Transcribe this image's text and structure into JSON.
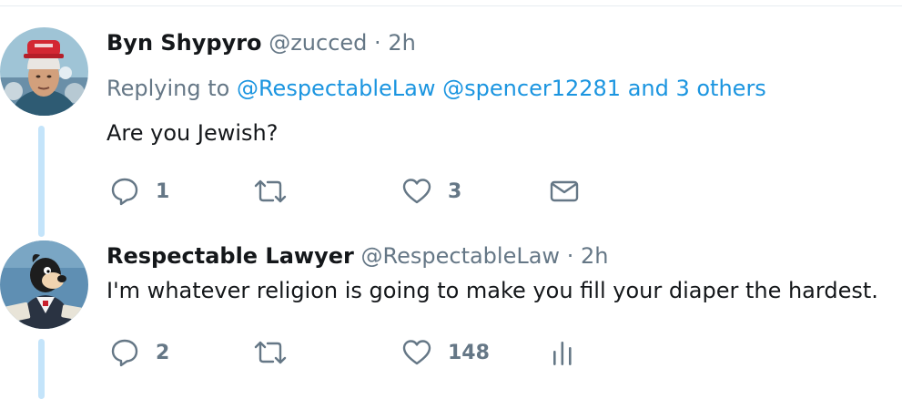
{
  "tweets": [
    {
      "display_name": "Byn Shypyro",
      "handle": "@zucced",
      "separator": "·",
      "time": "2h",
      "reply": {
        "prefix": "Replying to",
        "mentions": [
          "@RespectableLaw",
          "@spencer12281"
        ],
        "suffix": "and 3 others"
      },
      "text": "Are you Jewish?",
      "actions": {
        "reply_icon": "reply-icon",
        "reply_count": "1",
        "retweet_icon": "retweet-icon",
        "like_icon": "heart-icon",
        "like_count": "3",
        "extra_icon": "envelope-icon"
      }
    },
    {
      "display_name": "Respectable Lawyer",
      "handle": "@RespectableLaw",
      "separator": "·",
      "time": "2h",
      "text": "I'm whatever religion is going to make you fill your diaper the hardest.",
      "actions": {
        "reply_icon": "reply-icon",
        "reply_count": "2",
        "retweet_icon": "retweet-icon",
        "like_icon": "heart-icon",
        "like_count": "148",
        "extra_icon": "analytics-icon"
      }
    }
  ],
  "colors": {
    "text": "#14171a",
    "muted": "#657786",
    "link": "#1b95e0",
    "thread_line": "#c4e4fa",
    "divider": "#e6ecf0"
  }
}
